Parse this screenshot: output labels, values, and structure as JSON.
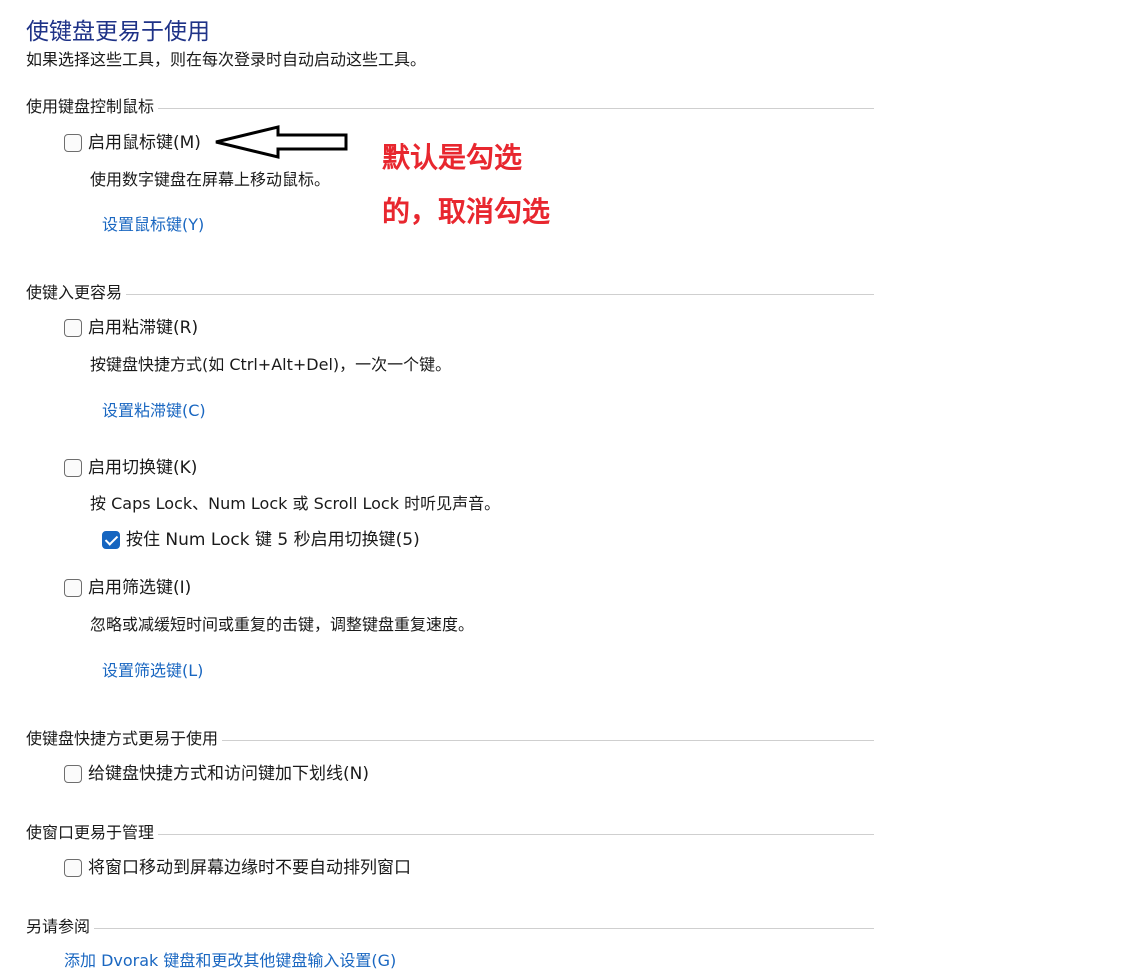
{
  "page": {
    "title": "使键盘更易于使用",
    "subtitle": "如果选择这些工具，则在每次登录时自动启动这些工具。"
  },
  "sections": {
    "mouse": {
      "header": "使用键盘控制鼠标",
      "mouse_keys": {
        "label": "启用鼠标键(M)",
        "checked": false,
        "description": "使用数字键盘在屏幕上移动鼠标。",
        "link": "设置鼠标键(Y)"
      }
    },
    "typing": {
      "header": "使键入更容易",
      "sticky_keys": {
        "label": "启用粘滞键(R)",
        "checked": false,
        "description": "按键盘快捷方式(如 Ctrl+Alt+Del)，一次一个键。",
        "link": "设置粘滞键(C)"
      },
      "toggle_keys": {
        "label": "启用切换键(K)",
        "checked": false,
        "description": "按 Caps Lock、Num Lock 或 Scroll Lock 时听见声音。",
        "sub_option": {
          "label": "按住 Num Lock 键 5 秒启用切换键(5)",
          "checked": true
        }
      },
      "filter_keys": {
        "label": "启用筛选键(I)",
        "checked": false,
        "description": "忽略或减缓短时间或重复的击键，调整键盘重复速度。",
        "link": "设置筛选键(L)"
      }
    },
    "shortcuts": {
      "header": "使键盘快捷方式更易于使用",
      "underline": {
        "label": "给键盘快捷方式和访问键加下划线(N)",
        "checked": false
      }
    },
    "windows": {
      "header": "使窗口更易于管理",
      "snap": {
        "label": "将窗口移动到屏幕边缘时不要自动排列窗口",
        "checked": false
      }
    },
    "see_also": {
      "header": "另请参阅",
      "link": "添加 Dvorak 键盘和更改其他键盘输入设置(G)"
    }
  },
  "annotation": {
    "line1": "默认是勾选",
    "line2": "的，取消勾选",
    "color": "#e8272f",
    "arrow_icon": "left-arrow-icon"
  },
  "colors": {
    "title": "#1e3287",
    "link": "#1a67c1",
    "checkbox_checked": "#1565c0"
  }
}
